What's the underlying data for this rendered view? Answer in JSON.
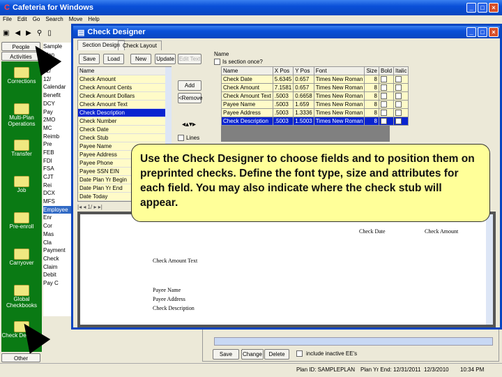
{
  "main_window": {
    "title": "Cafeteria for Windows",
    "menu": [
      "File",
      "Edit",
      "Go",
      "Search",
      "Move",
      "Help"
    ]
  },
  "sidebar": {
    "top_buttons": [
      "People",
      "Activities"
    ],
    "items": [
      "Corrections",
      "Multi-Plan Operations",
      "Transfer",
      "Job",
      "Pre-enroll",
      "Carryover",
      "Global Checkbooks",
      "Check Designer"
    ],
    "bottom_button": "Other"
  },
  "tree": [
    "Sample",
    "Plan",
    "2/",
    "12/",
    "12/",
    "Calendar",
    "Benefit",
    "DCY",
    "Pay",
    "2MO",
    "MC",
    "Reimb",
    "Pre",
    "FEB",
    "FDI",
    "FSA",
    "CJT",
    "Rei",
    "DCX",
    "MFS",
    "Employee",
    "Enr",
    "Cor",
    "Mas",
    "Cla",
    "Payment",
    "Check",
    "Claim",
    "Debit",
    "Pay C"
  ],
  "designer": {
    "title": "Check Designer",
    "tabs": [
      "Section Design",
      "Check Layout"
    ],
    "buttons": [
      "Save",
      "Load",
      "New",
      "Update",
      "Edit Text"
    ],
    "name_label": "Name",
    "once_label": "Is section once?",
    "list_header": "Name",
    "fields": [
      "Check Amount",
      "Check Amount Cents",
      "Check Amount Dollars",
      "Check Amount Text",
      "Check Description",
      "Check Number",
      "Check Date",
      "Check Stub",
      "Payee Name",
      "Payee Address",
      "Payee Phone",
      "Payee SSN EIN",
      "Date Plan Yr Begin",
      "Date Plan Yr End",
      "Date Today"
    ],
    "selected_field": "Check Description",
    "add_button": "Add",
    "remove_button": "<Remove",
    "lines_label": "Lines",
    "table_headers": [
      "Name",
      "X Pos",
      "Y Pos",
      "Font",
      "Size",
      "Bold",
      "Italic"
    ],
    "table_rows": [
      [
        "Check Date",
        "5.6345",
        "0.657",
        "Times New Roman",
        "8"
      ],
      [
        "Check Amount",
        "7.1581",
        "0.657",
        "Times New Roman",
        "8"
      ],
      [
        "Check Amount Text",
        ".5003",
        "0.6658",
        "Times New Roman",
        "8"
      ],
      [
        "Payee Name",
        ".5003",
        "1.659",
        "Times New Roman",
        "8"
      ],
      [
        "Payee Address",
        ".5003",
        "1.3336",
        "Times New Roman",
        "8"
      ],
      [
        "Check Description",
        ".5003",
        "1.5003",
        "Times New Roman",
        "8"
      ]
    ],
    "preview": {
      "check_date": "Check Date",
      "check_amount": "Check Amount",
      "amount_text": "Check Amount Text",
      "payee_name": "Payee Name",
      "payee_address": "Payee Address",
      "description": "Check Description"
    }
  },
  "callout": "Use the Check Designer to choose fields and to position them on preprinted checks.  Define the font type, size and attributes for each field.  You may also indicate where the check stub will appear.",
  "bottom": {
    "buttons": [
      "Save",
      "Change",
      "Delete"
    ],
    "inactive_label": "include inactive EE's"
  },
  "status": {
    "plan_id": "Plan ID: SAMPLEPLAN",
    "plan_yr_end": "Plan Yr End: 12/31/2011",
    "date": "12/3/2010",
    "time": "10:34 PM"
  }
}
